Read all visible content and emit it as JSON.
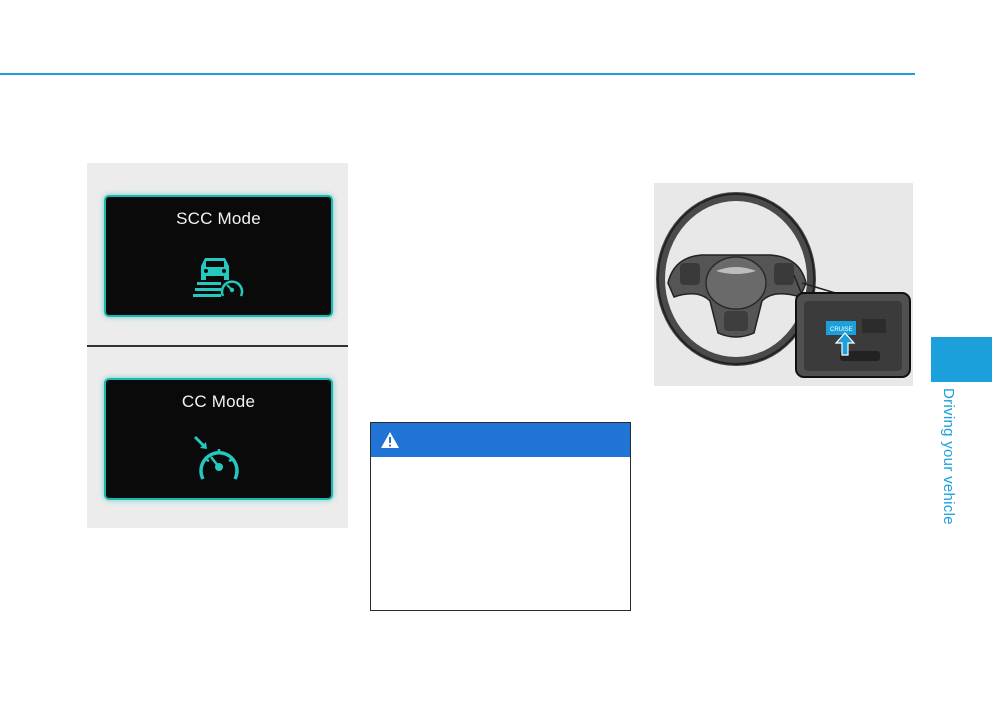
{
  "left_figure": {
    "panel_scc": {
      "title": "SCC Mode",
      "icon": "scc-mode-icon"
    },
    "panel_cc": {
      "title": "CC Mode",
      "icon": "cc-mode-icon"
    }
  },
  "steering_figure": {
    "switch_label": "CRUISE",
    "icon": "steering-wheel-illustration"
  },
  "warning": {
    "icon": "warning-triangle-icon"
  },
  "side_tab": {
    "label": "Driving your vehicle"
  },
  "colors": {
    "accent": "#1ba0dc",
    "warning_header": "#1f74d6",
    "display_glow": "#19b9b0"
  }
}
